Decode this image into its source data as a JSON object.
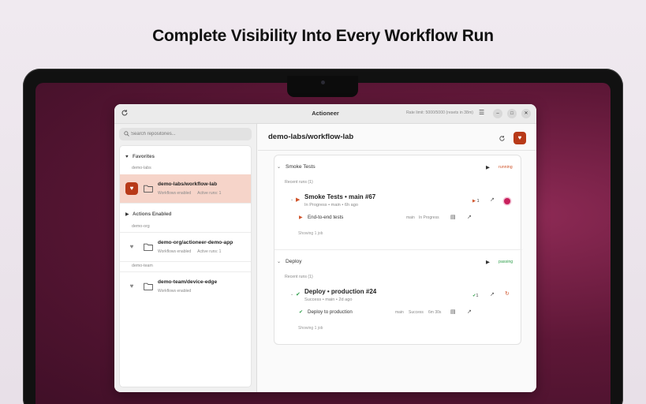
{
  "headline": "Complete Visibility Into Every Workflow Run",
  "window": {
    "title": "Actioneer",
    "rate_limit": "Rate limit: 5000/5000 (resets in 38m)",
    "minimize": "–",
    "maximize": "□",
    "close": "✕"
  },
  "sidebar": {
    "search_placeholder": "Search repositories...",
    "favorites_label": "Favorites",
    "actions_enabled_label": "Actions Enabled",
    "groups": {
      "fav_owner": "demo-labs",
      "org1": "demo-org",
      "org2": "demo-team"
    },
    "repos": [
      {
        "name": "demo-labs/workflow-lab",
        "status": "Workflows enabled",
        "active": "Active runs: 1",
        "favorite": true,
        "selected": true
      },
      {
        "name": "demo-org/actioneer-demo-app",
        "status": "Workflows enabled",
        "active": "Active runs: 1",
        "favorite": false,
        "selected": false
      },
      {
        "name": "demo-team/device-edge",
        "status": "Workflows enabled",
        "active": "",
        "favorite": false,
        "selected": false
      }
    ]
  },
  "main": {
    "repo_title": "demo-labs/workflow-lab",
    "workflows": [
      {
        "name": "Smoke Tests",
        "status": "running",
        "recent_label": "Recent runs (1)",
        "run": {
          "title": "Smoke Tests • main #67",
          "subtitle": "In Progress • main • 6h ago",
          "job_count": "1"
        },
        "job": {
          "name": "End-to-end tests",
          "branch": "main",
          "state": "In Progress",
          "duration": ""
        },
        "showing": "Showing 1 job"
      },
      {
        "name": "Deploy",
        "status": "passing",
        "recent_label": "Recent runs (1)",
        "run": {
          "title": "Deploy • production #24",
          "subtitle": "Success • main • 2d ago",
          "job_count": "1"
        },
        "job": {
          "name": "Deploy to production",
          "branch": "main",
          "state": "Success",
          "duration": "6m 30s"
        },
        "showing": "Showing 1 job"
      }
    ]
  },
  "colors": {
    "accent": "#b83a19",
    "running": "#d0542b",
    "passing": "#2e9e4a",
    "selected_row": "#f6d4c9"
  }
}
